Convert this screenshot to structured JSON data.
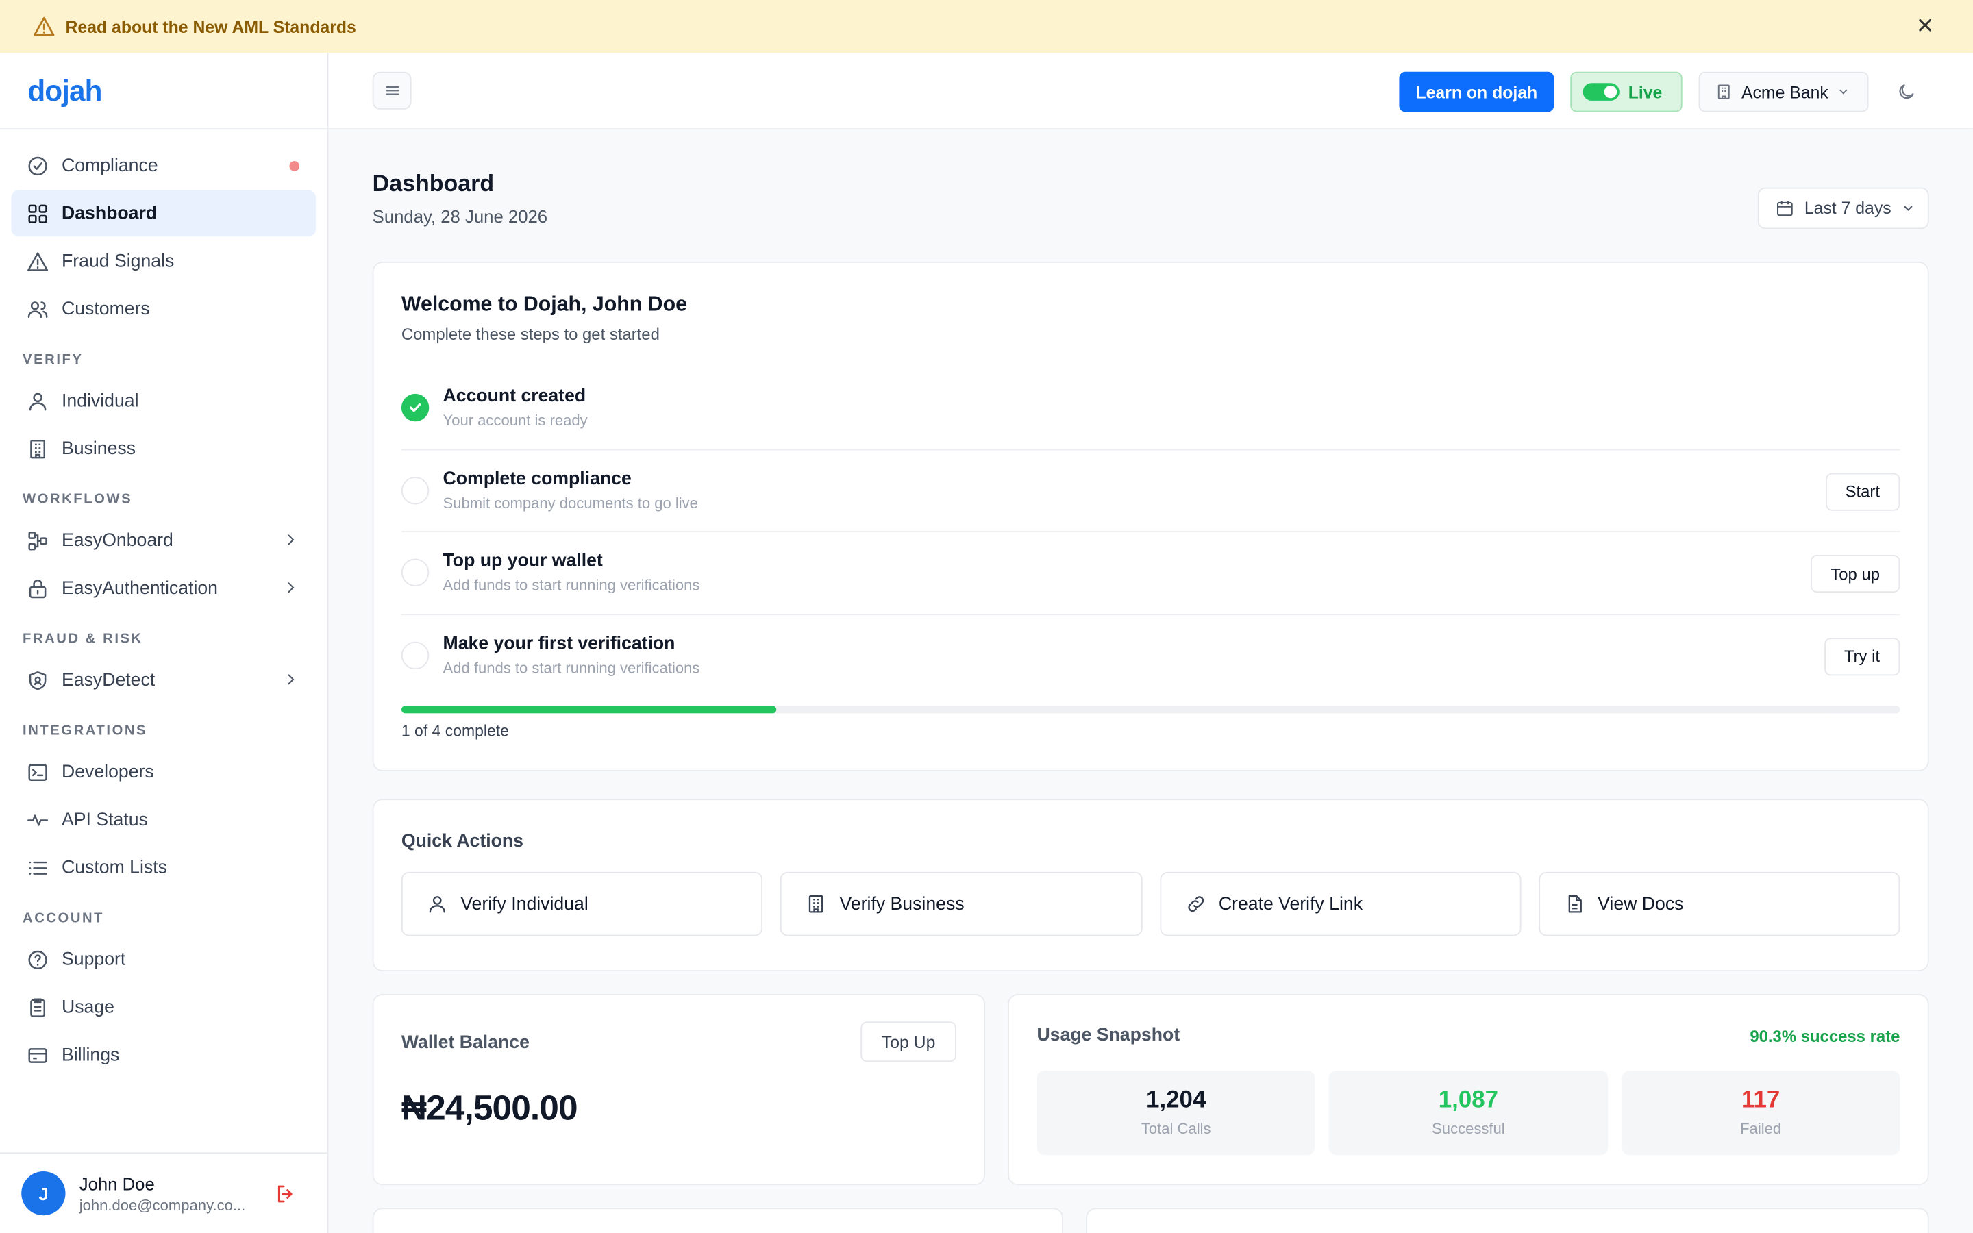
{
  "banner": {
    "text": "Read about the New AML Standards"
  },
  "brand": {
    "logo": "dojah",
    "accent": "#1a73e8"
  },
  "sidebar": {
    "main": [
      {
        "label": "Compliance",
        "icon": "check-circle-icon",
        "has_dot": true
      },
      {
        "label": "Dashboard",
        "icon": "grid-icon",
        "active": true
      },
      {
        "label": "Fraud Signals",
        "icon": "warning-icon"
      },
      {
        "label": "Customers",
        "icon": "users-icon"
      }
    ],
    "sections": {
      "verify": "VERIFY",
      "workflows": "WORKFLOWS",
      "fraud": "FRAUD & RISK",
      "integrations": "INTEGRATIONS",
      "account": "ACCOUNT"
    },
    "verify": [
      {
        "label": "Individual",
        "icon": "user-icon"
      },
      {
        "label": "Business",
        "icon": "building-icon"
      }
    ],
    "workflows": [
      {
        "label": "EasyOnboard",
        "icon": "flow-icon"
      },
      {
        "label": "EasyAuthentication",
        "icon": "lock-icon"
      }
    ],
    "fraud": [
      {
        "label": "EasyDetect",
        "icon": "shield-icon"
      }
    ],
    "integrations": [
      {
        "label": "Developers",
        "icon": "terminal-icon"
      },
      {
        "label": "API Status",
        "icon": "pulse-icon"
      },
      {
        "label": "Custom Lists",
        "icon": "list-icon"
      }
    ],
    "account": [
      {
        "label": "Support",
        "icon": "help-icon"
      },
      {
        "label": "Usage",
        "icon": "clipboard-icon"
      },
      {
        "label": "Billings",
        "icon": "card-icon"
      }
    ],
    "user": {
      "initial": "J",
      "name": "John Doe",
      "email": "john.doe@company.co..."
    }
  },
  "topbar": {
    "learn_label": "Learn on dojah",
    "live_label": "Live",
    "org_label": "Acme Bank"
  },
  "page": {
    "title": "Dashboard",
    "date": "Sunday, 28 June 2026",
    "range_label": "Last 7 days"
  },
  "welcome": {
    "title": "Welcome to Dojah, John Doe",
    "subtitle": "Complete these steps to get started",
    "steps": [
      {
        "title": "Account created",
        "sub": "Your account is ready",
        "done": true,
        "button": ""
      },
      {
        "title": "Complete compliance",
        "sub": "Submit company documents to go live",
        "done": false,
        "button": "Start"
      },
      {
        "title": "Top up your wallet",
        "sub": "Add funds to start running verifications",
        "done": false,
        "button": "Top up"
      },
      {
        "title": "Make your first verification",
        "sub": "Add funds to start running verifications",
        "done": false,
        "button": "Try it"
      }
    ],
    "progress_fraction": 0.25,
    "progress_text": "1 of 4 complete"
  },
  "quick_actions": {
    "title": "Quick Actions",
    "items": [
      {
        "label": "Verify Individual",
        "icon": "user-icon"
      },
      {
        "label": "Verify Business",
        "icon": "building-icon"
      },
      {
        "label": "Create Verify Link",
        "icon": "link-icon"
      },
      {
        "label": "View Docs",
        "icon": "document-icon"
      }
    ]
  },
  "wallet": {
    "title": "Wallet Balance",
    "button": "Top Up",
    "amount": "₦24,500.00"
  },
  "usage": {
    "title": "Usage Snapshot",
    "rate": "90.3% success rate",
    "stats": [
      {
        "value": "1,204",
        "label": "Total Calls",
        "color": "#111827"
      },
      {
        "value": "1,087",
        "label": "Successful",
        "color": "#22c55e"
      },
      {
        "value": "117",
        "label": "Failed",
        "color": "#e53935"
      }
    ]
  }
}
